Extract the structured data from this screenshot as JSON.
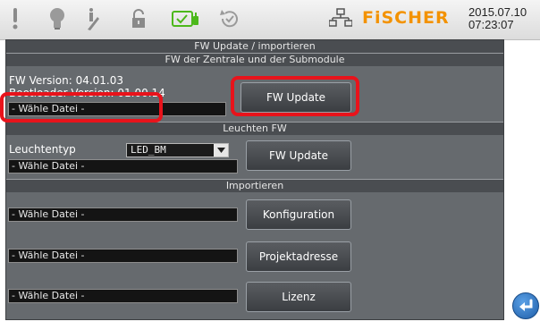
{
  "topbar": {
    "icons": [
      "alert-icon",
      "bulb-icon",
      "hand-icon",
      "lock-icon",
      "battery-icon",
      "refresh-icon",
      "network-icon"
    ],
    "brand": "FiSCHER",
    "date": "2015.07.10",
    "time": "07:23:07",
    "accent": "#f39200"
  },
  "page": {
    "title": "FW Update / importieren"
  },
  "section_fw": {
    "header": "FW der Zentrale und der Submodule",
    "fw_version": "FW Version: 04.01.03",
    "bootloader_version": "Bootloader Version: 01.00.14",
    "file_field": "- Wähle Datei -",
    "button": "FW Update"
  },
  "section_leuchten": {
    "header": "Leuchten FW",
    "type_label": "Leuchtentyp",
    "type_value": "LED_BM",
    "file_field": "- Wähle Datei -",
    "button": "FW Update"
  },
  "section_import": {
    "header": "Importieren",
    "rows": [
      {
        "file_field": "- Wähle Datei -",
        "button": "Konfiguration"
      },
      {
        "file_field": "- Wähle Datei -",
        "button": "Projektadresse"
      },
      {
        "file_field": "- Wähle Datei -",
        "button": "Lizenz"
      }
    ]
  },
  "highlight_color": "#e8131b",
  "back_button_icon": "return-arrow-icon"
}
